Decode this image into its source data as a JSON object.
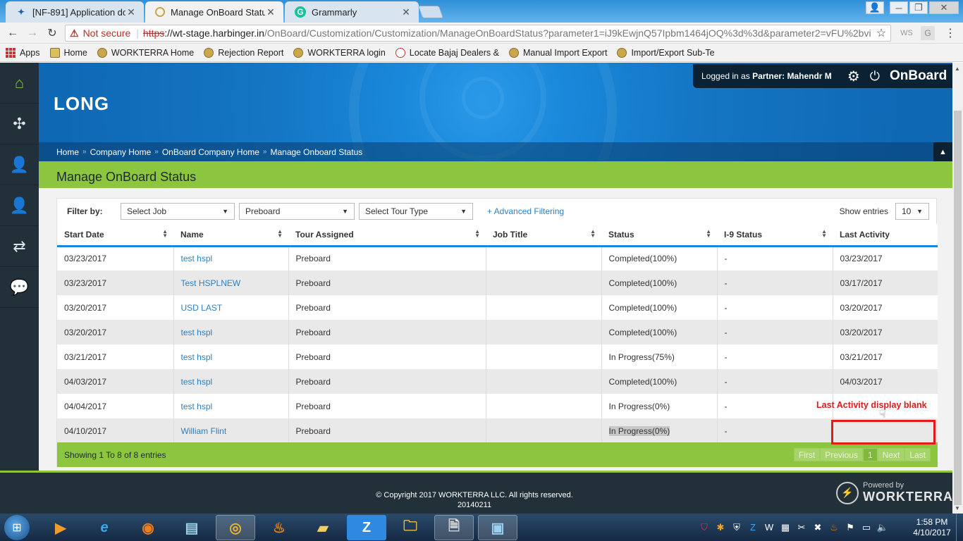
{
  "browser": {
    "tabs": [
      {
        "title": "[NF-891] Application do",
        "active": false
      },
      {
        "title": "Manage OnBoard Status",
        "active": true
      },
      {
        "title": "Grammarly",
        "active": false
      }
    ],
    "url": {
      "warning": "Not secure",
      "scheme": "https",
      "host": "://wt-stage.harbinger.in",
      "path": "/OnBoard/Customization/Customization/ManageOnBoardStatus?parameter1=iJ9kEwjnQ57Ipbm1464jOQ%3d%3d&parameter2=vFU%2bvi"
    },
    "bookmarks": [
      "Apps",
      "Home",
      "WORKTERRA Home",
      "Rejection Report",
      "WORKTERRA login",
      "Locate Bajaj Dealers &",
      "Manual Import Export",
      "Import/Export Sub-Te"
    ]
  },
  "app": {
    "org_title": "LONG",
    "user": {
      "prefix": "Logged in as",
      "role": "Partner:",
      "name": "Mahendr M"
    },
    "brand": "OnBoard",
    "breadcrumb": [
      "Home",
      "Company Home",
      "OnBoard Company Home",
      "Manage Onboard Status"
    ],
    "page_title": "Manage OnBoard Status",
    "sidebar_icons": [
      "home-icon",
      "puzzle-icon",
      "user-star-icon",
      "user-icon",
      "transfer-icon",
      "chat-icon"
    ]
  },
  "filters": {
    "label": "Filter by:",
    "job": "Select Job",
    "tour": "Preboard",
    "tour_type": "Select Tour Type",
    "advanced": "+ Advanced Filtering",
    "show_entries_label": "Show entries",
    "show_entries_value": "10"
  },
  "table": {
    "columns": [
      "Start Date",
      "Name",
      "Tour Assigned",
      "Job Title",
      "Status",
      "I-9 Status",
      "Last Activity"
    ],
    "rows": [
      {
        "start": "03/23/2017",
        "name": "test hspl",
        "tour": "Preboard",
        "job": "",
        "status": "Completed(100%)",
        "i9": "-",
        "last": "03/23/2017"
      },
      {
        "start": "03/23/2017",
        "name": "Test HSPLNEW",
        "tour": "Preboard",
        "job": "",
        "status": "Completed(100%)",
        "i9": "-",
        "last": "03/17/2017"
      },
      {
        "start": "03/20/2017",
        "name": "USD LAST",
        "tour": "Preboard",
        "job": "",
        "status": "Completed(100%)",
        "i9": "-",
        "last": "03/20/2017"
      },
      {
        "start": "03/20/2017",
        "name": "test hspl",
        "tour": "Preboard",
        "job": "",
        "status": "Completed(100%)",
        "i9": "-",
        "last": "03/20/2017"
      },
      {
        "start": "03/21/2017",
        "name": "test hspl",
        "tour": "Preboard",
        "job": "",
        "status": "In Progress(75%)",
        "i9": "-",
        "last": "03/21/2017"
      },
      {
        "start": "04/03/2017",
        "name": "test hspl",
        "tour": "Preboard",
        "job": "",
        "status": "Completed(100%)",
        "i9": "-",
        "last": "04/03/2017"
      },
      {
        "start": "04/04/2017",
        "name": "test hspl",
        "tour": "Preboard",
        "job": "",
        "status": "In Progress(0%)",
        "i9": "-",
        "last": ""
      },
      {
        "start": "04/10/2017",
        "name": "William Flint",
        "tour": "Preboard",
        "job": "",
        "status": "In Progress(0%)",
        "i9": "-",
        "last": ""
      }
    ]
  },
  "pager": {
    "info": "Showing 1 To 8 of 8 entries",
    "buttons": [
      "First",
      "Previous",
      "1",
      "Next",
      "Last"
    ]
  },
  "annotation": {
    "text": "Last Activity display blank",
    "color": "#d81c1c"
  },
  "footer": {
    "copyright": "© Copyright 2017 WORKTERRA LLC. All rights reserved.",
    "build": "20140211",
    "powered_by": "Powered by",
    "powered_brand": "WORKTERRA"
  },
  "taskbar": {
    "time": "1:58 PM",
    "date": "4/10/2017"
  },
  "colors": {
    "accent_blue": "#1a88da",
    "accent_green": "#8cc63f",
    "sidebar": "#22303a",
    "annotation_red": "#e01c1c"
  }
}
